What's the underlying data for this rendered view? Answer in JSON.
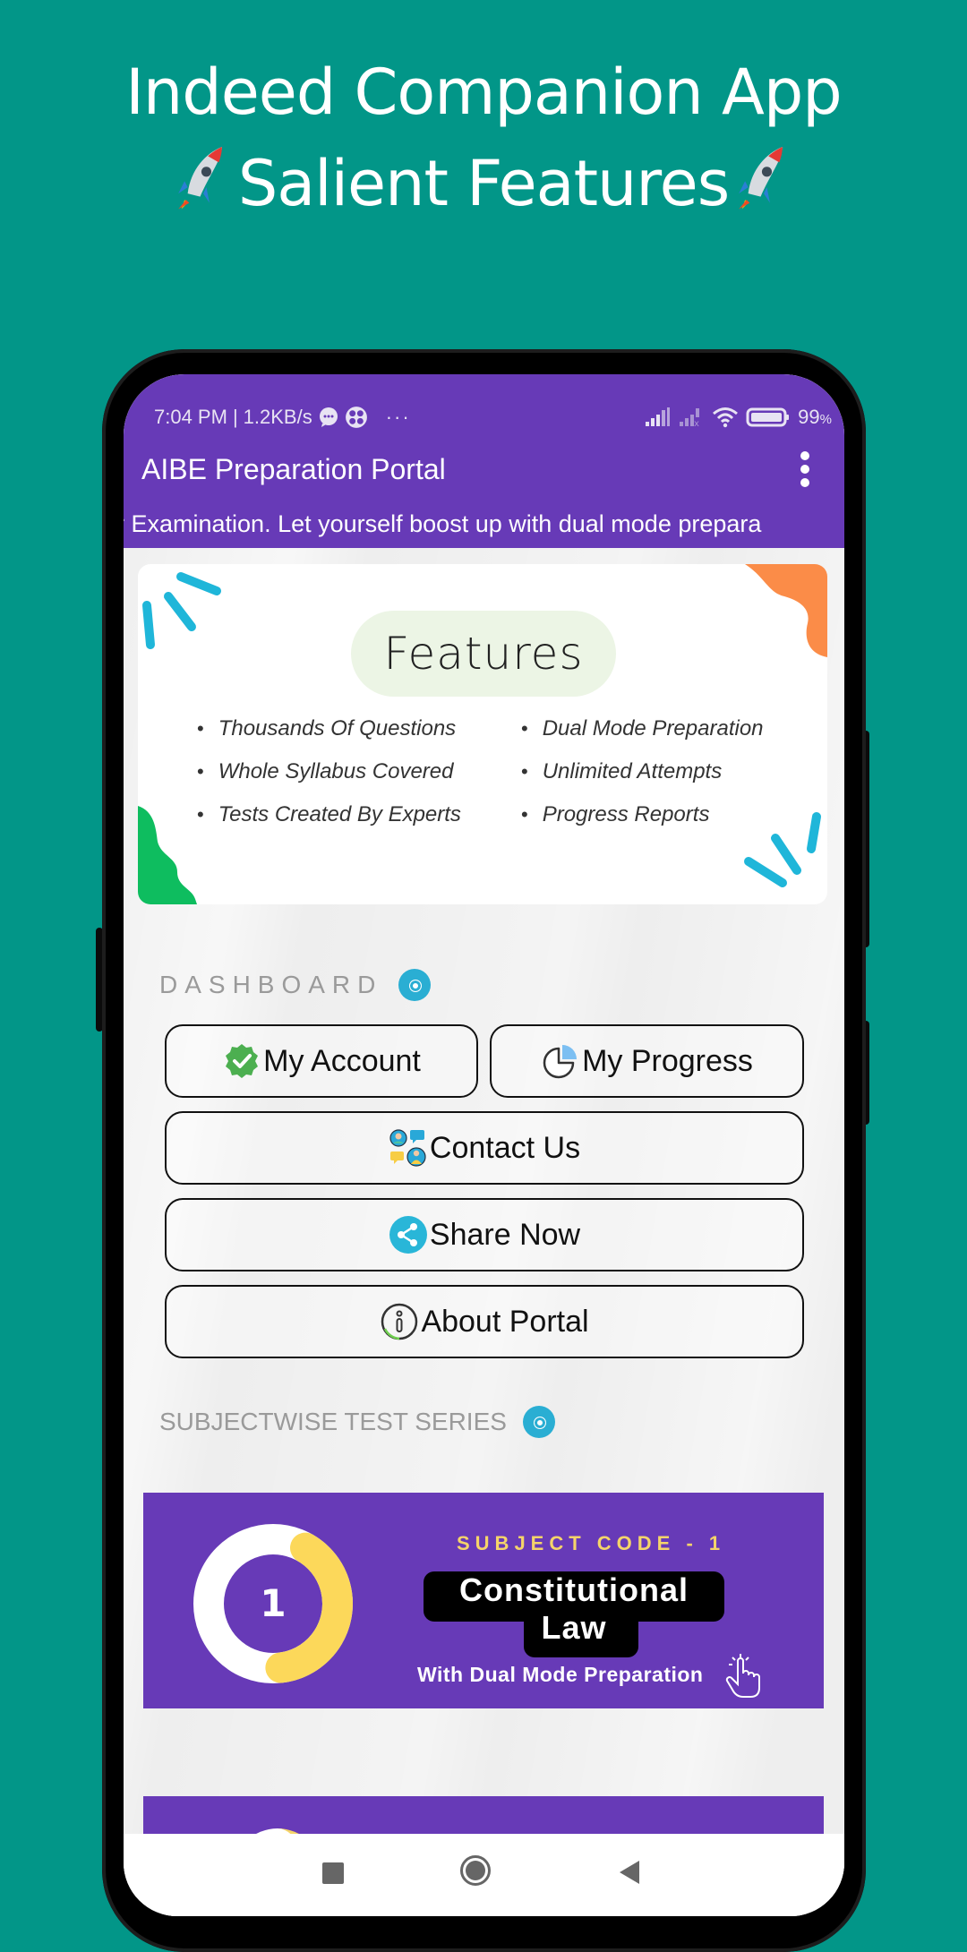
{
  "promo": {
    "title_line1": "Indeed Companion App",
    "title_line2": "Salient Features",
    "decor_icon": "rocket-emoji"
  },
  "status_bar": {
    "time": "7:04 PM",
    "separator": "|",
    "net_speed": "1.2KB/s",
    "more": "···",
    "battery_percent": "99",
    "battery_unit": "%",
    "icons": [
      "message-icon",
      "app-icon",
      "signal-icon",
      "signal-no-sim-icon",
      "wifi-icon",
      "battery-icon"
    ]
  },
  "app_bar": {
    "title": "AIBE Preparation Portal",
    "menu_icon": "more-vert-icon",
    "marquee": "r Examination. Let yourself boost up with dual mode prepara"
  },
  "feature_banner": {
    "heading": "Features",
    "left_items": [
      "Thousands Of Questions",
      "Whole Syllabus Covered",
      "Tests Created By Experts"
    ],
    "right_items": [
      "Dual Mode Preparation",
      "Unlimited Attempts",
      "Progress Reports"
    ],
    "colors": {
      "pill": "#ecf5e5",
      "accent_blue": "#1fb6d9",
      "accent_orange": "#fb8c48",
      "accent_green": "#0ebd5f"
    }
  },
  "dashboard": {
    "label": "DASHBOARD",
    "buttons": [
      {
        "label": "My Account",
        "icon": "verified-check-icon"
      },
      {
        "label": "My Progress",
        "icon": "pie-chart-icon"
      },
      {
        "label": "Contact Us",
        "icon": "contact-people-icon"
      },
      {
        "label": "Share Now",
        "icon": "share-icon"
      },
      {
        "label": "About Portal",
        "icon": "info-icon"
      }
    ]
  },
  "subjectwise": {
    "label": "SUBJECTWISE TEST SERIES",
    "subjects": [
      {
        "number": "1",
        "code_label": "SUBJECT CODE - 1",
        "name_line1": "Constitutional",
        "name_line2": "Law",
        "subtitle": "With Dual Mode Preparation"
      }
    ]
  },
  "nav_bar": {
    "buttons": [
      "recents-button",
      "home-button",
      "back-button"
    ]
  },
  "colors": {
    "background": "#029688",
    "app_primary": "#673ab7",
    "subject_code": "#f5d46a",
    "ring_yellow": "#fcd85a"
  }
}
